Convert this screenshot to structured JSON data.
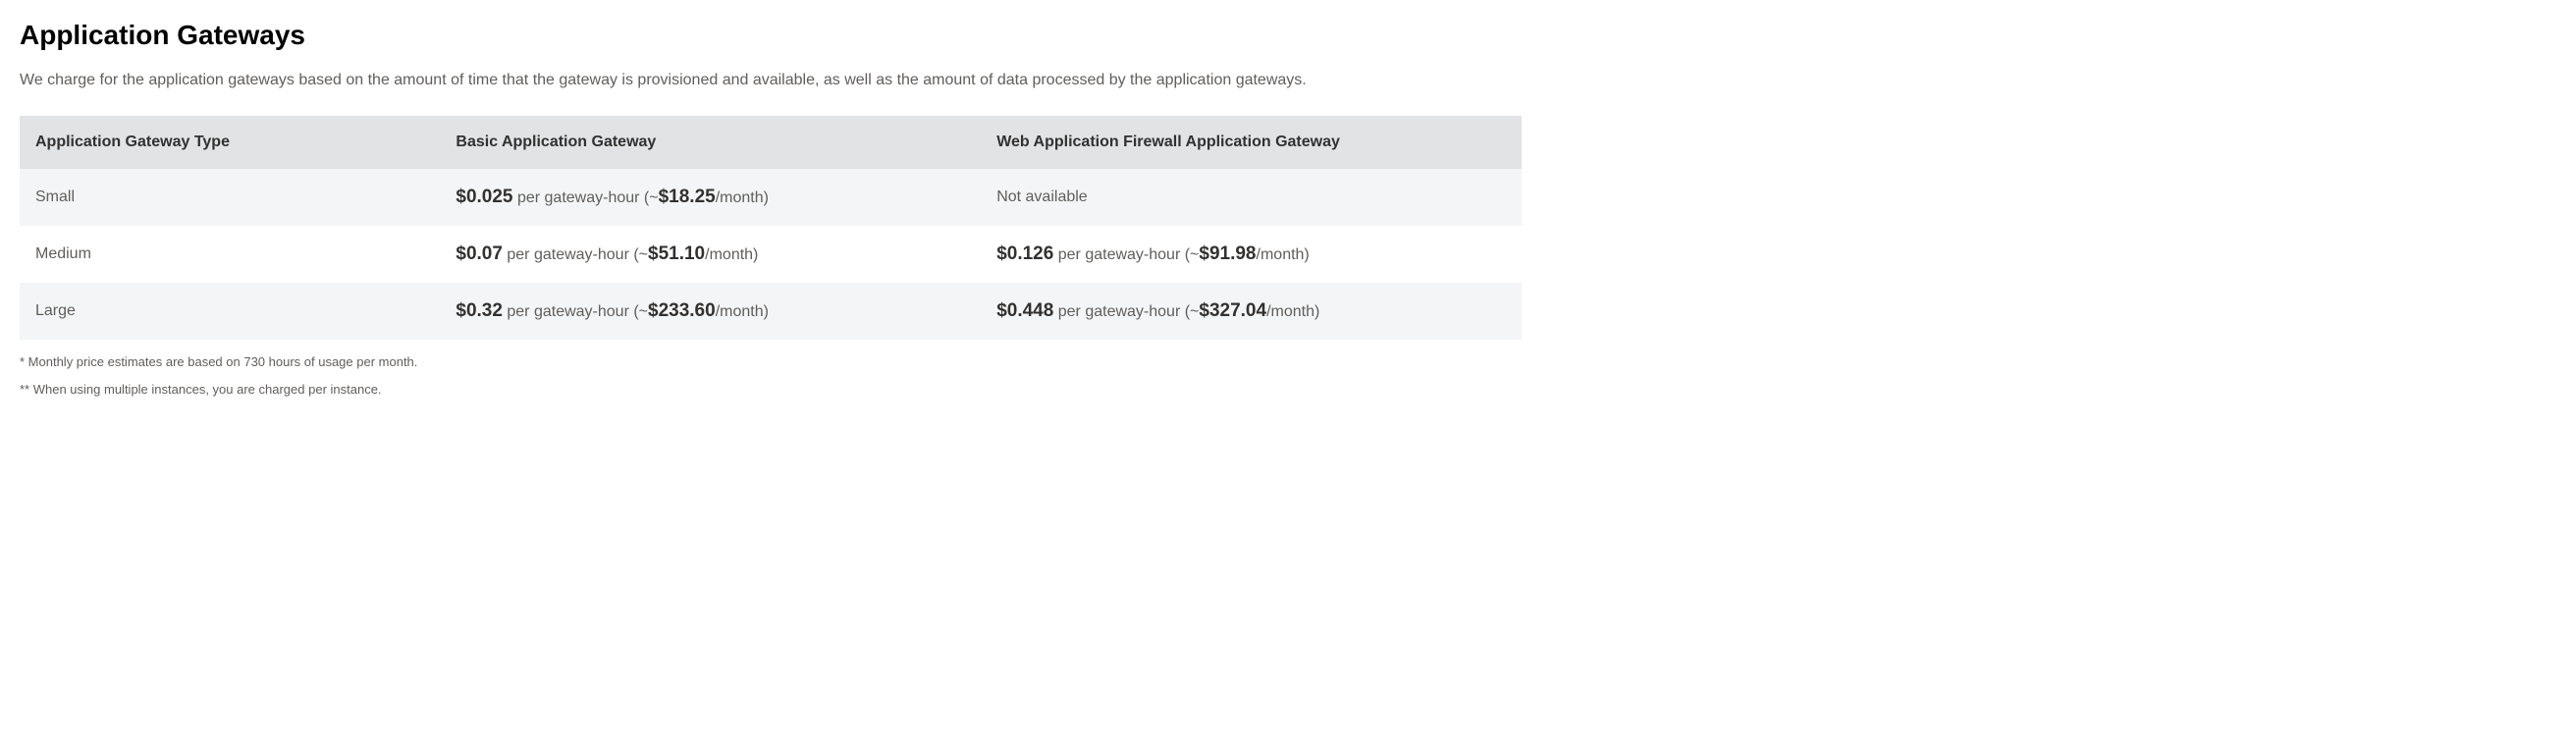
{
  "heading": "Application Gateways",
  "description": "We charge for the application gateways based on the amount of time that the gateway is provisioned and available, as well as the amount of data processed by the application gateways.",
  "table": {
    "headers": {
      "col1": "Application Gateway Type",
      "col2": "Basic Application Gateway",
      "col3": "Web Application Firewall Application Gateway"
    },
    "rows": [
      {
        "type": "Small",
        "basic": {
          "available": true,
          "hourly": "$0.025",
          "unit": " per gateway-hour (~",
          "monthly": "$18.25",
          "monthSuffix": "/month)"
        },
        "waf": {
          "available": false,
          "text": "Not available"
        }
      },
      {
        "type": "Medium",
        "basic": {
          "available": true,
          "hourly": "$0.07",
          "unit": " per gateway-hour (~",
          "monthly": "$51.10",
          "monthSuffix": "/month)"
        },
        "waf": {
          "available": true,
          "hourly": "$0.126",
          "unit": " per gateway-hour (~",
          "monthly": "$91.98",
          "monthSuffix": "/month)"
        }
      },
      {
        "type": "Large",
        "basic": {
          "available": true,
          "hourly": "$0.32",
          "unit": " per gateway-hour (~",
          "monthly": "$233.60",
          "monthSuffix": "/month)"
        },
        "waf": {
          "available": true,
          "hourly": "$0.448",
          "unit": " per gateway-hour (~",
          "monthly": "$327.04",
          "monthSuffix": "/month)"
        }
      }
    ]
  },
  "footnotes": {
    "f1": "* Monthly price estimates are based on 730 hours of usage per month.",
    "f2": "** When using multiple instances, you are charged per instance."
  }
}
